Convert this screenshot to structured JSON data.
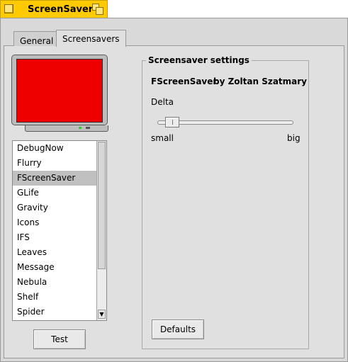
{
  "window": {
    "title": "ScreenSaver"
  },
  "tabs": [
    {
      "label": "General",
      "selected": false
    },
    {
      "label": "Screensavers",
      "selected": true
    }
  ],
  "preview": {
    "screen_color": "#ee0000"
  },
  "screensaver_list": {
    "items": [
      "DebugNow",
      "Flurry",
      "FScreenSaver",
      "GLife",
      "Gravity",
      "Icons",
      "IFS",
      "Leaves",
      "Message",
      "Nebula",
      "Shelf",
      "Spider"
    ],
    "selected": "FScreenSaver"
  },
  "buttons": {
    "test": "Test",
    "defaults": "Defaults"
  },
  "settings": {
    "group_label": "Screensaver settings",
    "name": "FScreenSaver",
    "author": "by Zoltan Szatmary",
    "slider": {
      "label": "Delta",
      "min_label": "small",
      "max_label": "big",
      "value_fraction": 0.05
    }
  },
  "colors": {
    "title_tab": "#ffcb00",
    "selection": "#c0c0c0",
    "window_bg": "#d9d9d9"
  }
}
